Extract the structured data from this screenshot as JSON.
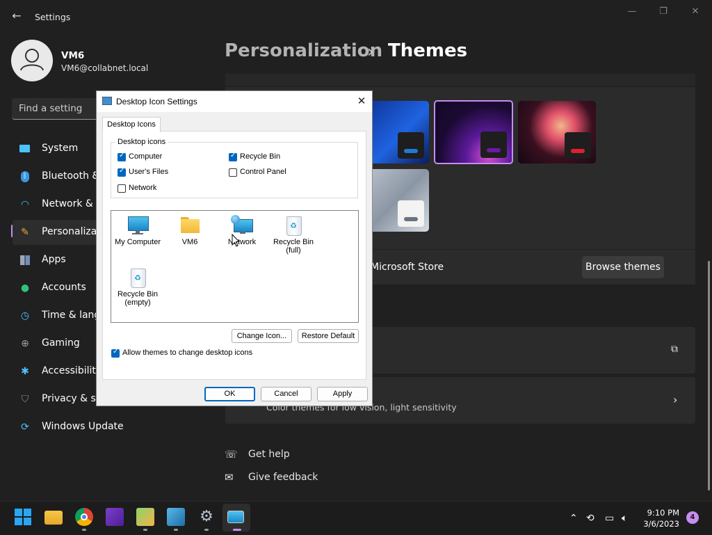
{
  "window": {
    "app_title": "Settings"
  },
  "profile": {
    "name": "VM6",
    "email": "VM6@collabnet.local"
  },
  "search": {
    "placeholder": "Find a setting"
  },
  "sidebar": {
    "items": [
      {
        "label": "System",
        "icon": "monitor-icon",
        "color": "#4cc2ff"
      },
      {
        "label": "Bluetooth & devices",
        "icon": "bluetooth-icon",
        "color": "#3a96dd"
      },
      {
        "label": "Network & internet",
        "icon": "wifi-icon",
        "color": "#4cc2ff"
      },
      {
        "label": "Personalization",
        "icon": "brush-icon",
        "color": "#f2a33a",
        "active": true
      },
      {
        "label": "Apps",
        "icon": "apps-icon",
        "color": "#9aa7b8"
      },
      {
        "label": "Accounts",
        "icon": "person-icon",
        "color": "#2fc27a"
      },
      {
        "label": "Time & language",
        "icon": "clock-icon",
        "color": "#4cc2ff"
      },
      {
        "label": "Gaming",
        "icon": "gamepad-icon",
        "color": "#a0a0a0"
      },
      {
        "label": "Accessibility",
        "icon": "accessibility-icon",
        "color": "#4cc2ff"
      },
      {
        "label": "Privacy & security",
        "icon": "shield-icon",
        "color": "#8e8e8e"
      },
      {
        "label": "Windows Update",
        "icon": "update-icon",
        "color": "#4cc2ff"
      }
    ]
  },
  "breadcrumb": {
    "parent": "Personalization",
    "separator": "›",
    "current": "Themes"
  },
  "themes": {
    "store_text": "Microsoft Store",
    "browse_button": "Browse themes",
    "thumbnails": [
      {
        "name": "windows-blue",
        "accent": "#1f7ad6",
        "selected": false
      },
      {
        "name": "glow",
        "accent": "#6a1aa6",
        "selected": true
      },
      {
        "name": "flower",
        "accent": "#e0202c",
        "selected": false
      },
      {
        "name": "sculpture",
        "accent": "#6a7480",
        "selected": false
      }
    ]
  },
  "contrast_row": {
    "subtitle": "Color themes for low vision, light sensitivity"
  },
  "links": {
    "help": "Get help",
    "feedback": "Give feedback"
  },
  "dialog": {
    "title": "Desktop Icon Settings",
    "tab": "Desktop Icons",
    "group_title": "Desktop icons",
    "checkboxes": [
      {
        "label": "Computer",
        "checked": true
      },
      {
        "label": "Recycle Bin",
        "checked": true
      },
      {
        "label": "User's Files",
        "checked": true
      },
      {
        "label": "Control Panel",
        "checked": false
      },
      {
        "label": "Network",
        "checked": false
      }
    ],
    "icons": [
      {
        "line1": "My Computer",
        "line2": "",
        "icon": "computer-icon"
      },
      {
        "line1": "VM6",
        "line2": "",
        "icon": "folder-icon"
      },
      {
        "line1": "Network",
        "line2": "",
        "icon": "network-icon"
      },
      {
        "line1": "Recycle Bin",
        "line2": "(full)",
        "icon": "recycle-bin-full-icon"
      },
      {
        "line1": "Recycle Bin",
        "line2": "(empty)",
        "icon": "recycle-bin-empty-icon"
      }
    ],
    "change_icon": "Change Icon...",
    "restore_default": "Restore Default",
    "allow_themes": {
      "label": "Allow themes to change desktop icons",
      "checked": true
    },
    "ok": "OK",
    "cancel": "Cancel",
    "apply": "Apply"
  },
  "taskbar": {
    "time": "9:10 PM",
    "date": "3/6/2023",
    "notifications": "4"
  }
}
